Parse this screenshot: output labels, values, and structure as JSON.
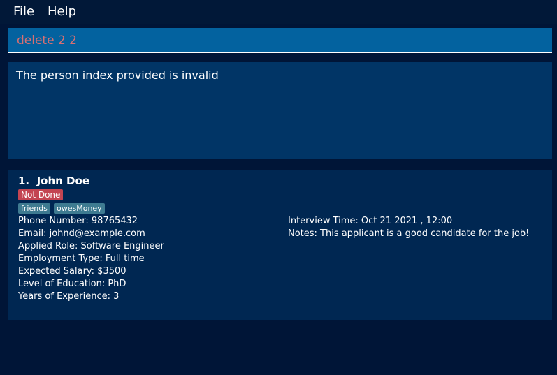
{
  "menu": {
    "file": "File",
    "help": "Help"
  },
  "command": {
    "text": "delete 2 2"
  },
  "result": {
    "message": "The person index provided is invalid"
  },
  "card": {
    "index": "1.",
    "name": "John Doe",
    "status": "Not Done",
    "tags": [
      "friends",
      "owesMoney"
    ],
    "left_fields": [
      "Phone Number: 98765432",
      "Email: johnd@example.com",
      "Applied Role: Software Engineer",
      "Employment Type: Full time",
      "Expected Salary: $3500",
      "Level of Education: PhD",
      "Years of Experience: 3"
    ],
    "right_fields": [
      "Interview Time: Oct 21 2021 , 12:00",
      "Notes: This applicant is a good candidate for the job!"
    ]
  },
  "colors": {
    "background": "#001537",
    "command_box": "#03629f",
    "command_text": "#d86f72",
    "result_box": "#013566",
    "list_panel": "#002752",
    "status_badge": "#c34552",
    "tag": "#3e7b91"
  }
}
